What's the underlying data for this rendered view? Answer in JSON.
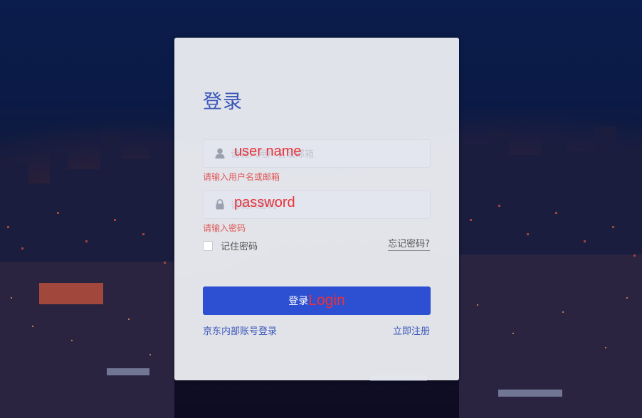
{
  "login": {
    "title": "登录",
    "username": {
      "placeholder": "请输入用户名或邮箱",
      "overlay_label": "user name",
      "error": "请输入用户名或邮箱",
      "icon": "user-icon"
    },
    "password": {
      "placeholder": "请输入密码",
      "overlay_label": "password",
      "error": "请输入密码",
      "icon": "lock-icon"
    },
    "remember_label": "记住密码",
    "forgot_label": "忘记密码?",
    "submit": {
      "label": "登录",
      "overlay_label": "Login"
    },
    "internal_login_link": "京东内部账号登录",
    "register_link": "立即注册"
  },
  "colors": {
    "accent": "#3b57b8",
    "button": "#2d4fd1",
    "error": "#e05656",
    "annotation": "#e8323a"
  }
}
